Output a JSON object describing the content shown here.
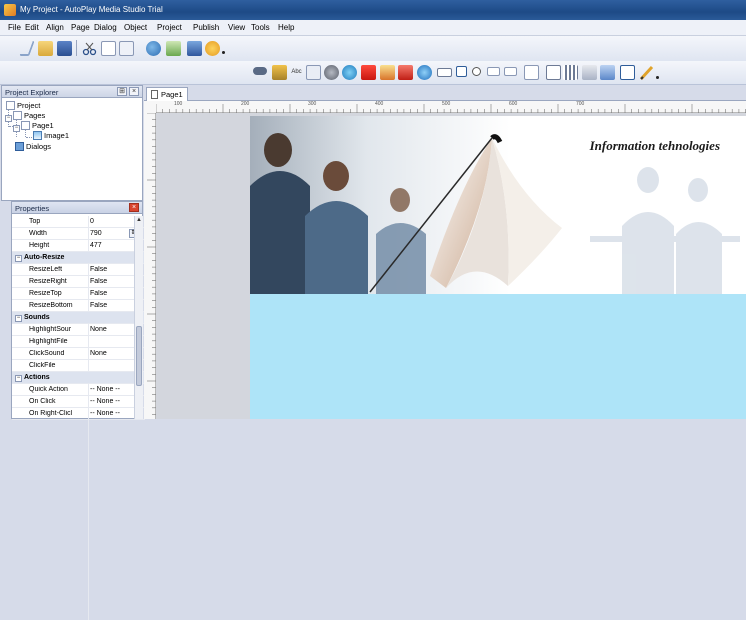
{
  "window": {
    "title": "My Project - AutoPlay Media Studio Trial"
  },
  "menu": [
    "File",
    "Edit",
    "Align",
    "Page",
    "Dialog",
    "Object",
    "Project",
    "Publish",
    "View",
    "Tools",
    "Help"
  ],
  "project_explorer": {
    "title": "Project Explorer",
    "tree": {
      "root": "Project",
      "pages": "Pages",
      "page1": "Page1",
      "image1": "Image1",
      "dialogs": "Dialogs"
    }
  },
  "properties": {
    "title": "Properties",
    "rows": [
      {
        "name": "Top",
        "value": "0"
      },
      {
        "name": "Width",
        "value": "790"
      },
      {
        "name": "Height",
        "value": "477"
      }
    ],
    "groups": [
      {
        "name": "Auto-Resize",
        "rows": [
          {
            "name": "ResizeLeft",
            "value": "False"
          },
          {
            "name": "ResizeRight",
            "value": "False"
          },
          {
            "name": "ResizeTop",
            "value": "False"
          },
          {
            "name": "ResizeBottom",
            "value": "False"
          }
        ]
      },
      {
        "name": "Sounds",
        "rows": [
          {
            "name": "HighlightSour",
            "value": "None"
          },
          {
            "name": "HighlightFile",
            "value": ""
          },
          {
            "name": "ClickSound",
            "value": "None"
          },
          {
            "name": "ClickFile",
            "value": ""
          }
        ]
      },
      {
        "name": "Actions",
        "rows": [
          {
            "name": "Quick Action",
            "value": "-- None --"
          },
          {
            "name": "On Click",
            "value": "-- None --"
          },
          {
            "name": "On Right-Clicl",
            "value": "-- None --"
          }
        ]
      }
    ]
  },
  "document": {
    "tab_label": "Page1",
    "ruler_marks": [
      "100",
      "200",
      "300",
      "400",
      "500",
      "600",
      "700"
    ],
    "banner_text": "Information tehnologies"
  },
  "colors": {
    "titlebar": "#1d4a86",
    "page_background": "#aee4f8",
    "banner_background": "#ffffff"
  }
}
